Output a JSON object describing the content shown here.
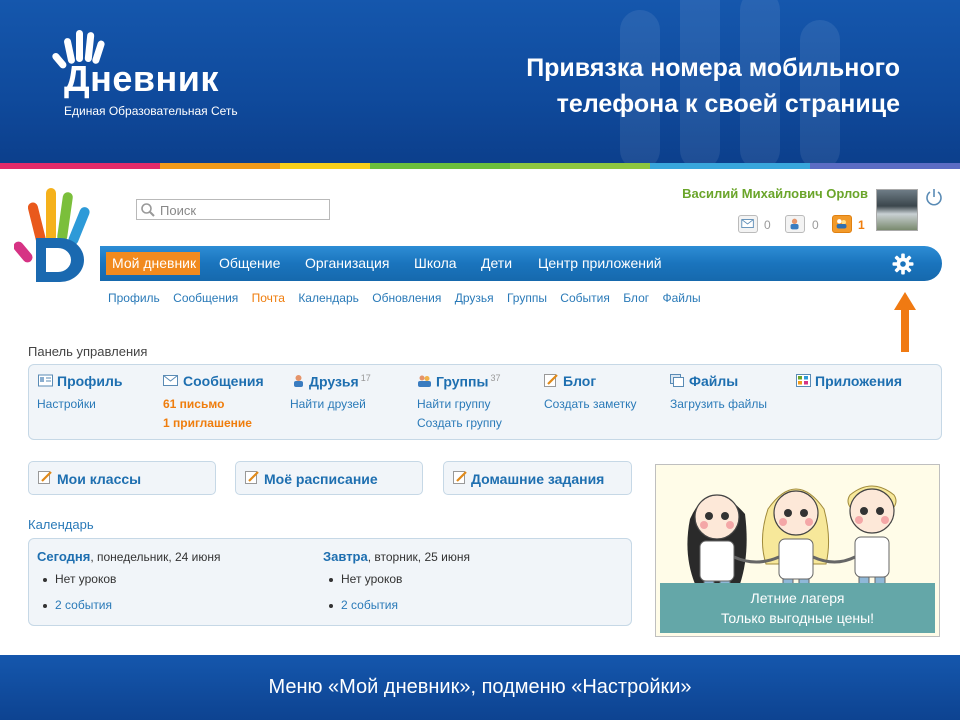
{
  "slide": {
    "logo_text": "Дневник",
    "logo_subtitle": "Единая Образовательная Сеть",
    "title_line1": "Привязка номера мобильного",
    "title_line2": "телефона к своей странице",
    "footer": "Меню «Мой дневник», подменю «Настройки»"
  },
  "colors": {
    "brand_blue": "#1557ad",
    "nav_blue": "#1a74bd",
    "accent_orange": "#f18a1e",
    "link_blue": "#2a7ab8",
    "user_green": "#6aa52a"
  },
  "header": {
    "search_placeholder": "Поиск",
    "user_name": "Василий Михайлович Орлов",
    "counters": [
      {
        "icon": "mail-icon",
        "count": "0"
      },
      {
        "icon": "friend-request-icon",
        "count": "0"
      },
      {
        "icon": "group-invite-icon",
        "count": "1"
      }
    ]
  },
  "nav": {
    "items": [
      "Мой дневник",
      "Общение",
      "Организация",
      "Школа",
      "Дети",
      "Центр приложений"
    ],
    "active": "Мой дневник"
  },
  "subnav": {
    "items": [
      "Профиль",
      "Сообщения",
      "Почта",
      "Календарь",
      "Обновления",
      "Друзья",
      "Группы",
      "События",
      "Блог",
      "Файлы"
    ],
    "active": "Почта"
  },
  "panel": {
    "label": "Панель управления",
    "sections": [
      {
        "title": "Профиль",
        "icon": "profile-icon",
        "links": [
          "Настройки"
        ]
      },
      {
        "title": "Сообщения",
        "icon": "messages-icon",
        "links": [
          "61 письмо",
          "1 приглашение"
        ]
      },
      {
        "title": "Друзья",
        "icon": "friends-icon",
        "count": "17",
        "links": [
          "Найти друзей"
        ]
      },
      {
        "title": "Группы",
        "icon": "groups-icon",
        "count": "37",
        "links": [
          "Найти группу",
          "Создать группу"
        ]
      },
      {
        "title": "Блог",
        "icon": "blog-icon",
        "links": [
          "Создать заметку"
        ]
      },
      {
        "title": "Файлы",
        "icon": "files-icon",
        "links": [
          "Загрузить файлы"
        ]
      },
      {
        "title": "Приложения",
        "icon": "apps-icon",
        "links": []
      }
    ]
  },
  "quick": {
    "classes": "Мои классы",
    "schedule": "Моё расписание",
    "homework": "Домашние задания"
  },
  "calendar": {
    "label": "Календарь",
    "today": {
      "day": "Сегодня",
      "date": ", понедельник, 24 июня",
      "item": "Нет уроков",
      "events": "2 события"
    },
    "tomorrow": {
      "day": "Завтра",
      "date": ", вторник, 25 июня",
      "item": "Нет уроков",
      "events": "2 события"
    }
  },
  "banner": {
    "line1": "Летние лагеря",
    "line2": "Только выгодные цены!"
  }
}
